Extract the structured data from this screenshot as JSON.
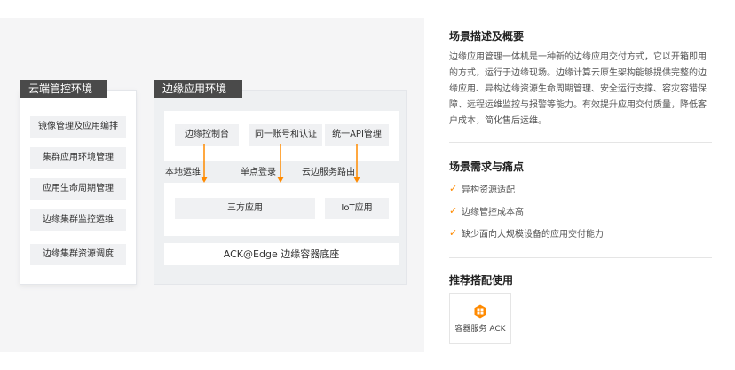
{
  "diagram": {
    "cloud": {
      "title": "云端管控环境",
      "items": [
        "镜像管理及应用编排",
        "集群应用环境管理",
        "应用生命周期管理",
        "边缘集群监控运维",
        "边缘集群资源调度"
      ]
    },
    "edge": {
      "title": "边缘应用环境",
      "top_boxes": [
        "边缘控制台",
        "同一账号和认证",
        "统一API管理"
      ],
      "connectors": [
        "本地运维",
        "单点登录",
        "云边服务路由"
      ],
      "mid_boxes": [
        "三方应用",
        "IoT应用"
      ],
      "base": "ACK@Edge 边缘容器底座"
    },
    "arrow_color": "#ff8a00"
  },
  "scenario": {
    "title": "场景描述及概要",
    "description": "边缘应用管理一体机是一种新的边缘应用交付方式，它以开箱即用的方式，运行于边缘现场。边缘计算云原生架构能够提供完整的边缘应用、异构边缘资源生命周期管理、安全运行支撑、容灾容错保障、远程运维监控与报警等能力。有效提升应用交付质量，降低客户成本，简化售后运维。"
  },
  "needs": {
    "title": "场景需求与痛点",
    "items": [
      "异构资源适配",
      "边缘管控成本高",
      "缺少面向大规模设备的应用交付能力"
    ]
  },
  "recommend": {
    "title": "推荐搭配使用",
    "product": {
      "label": "容器服务 ACK",
      "icon": "container-service-icon"
    }
  },
  "colors": {
    "accent": "#ff8a00",
    "panel_title_bg": "#4a4a4a"
  }
}
